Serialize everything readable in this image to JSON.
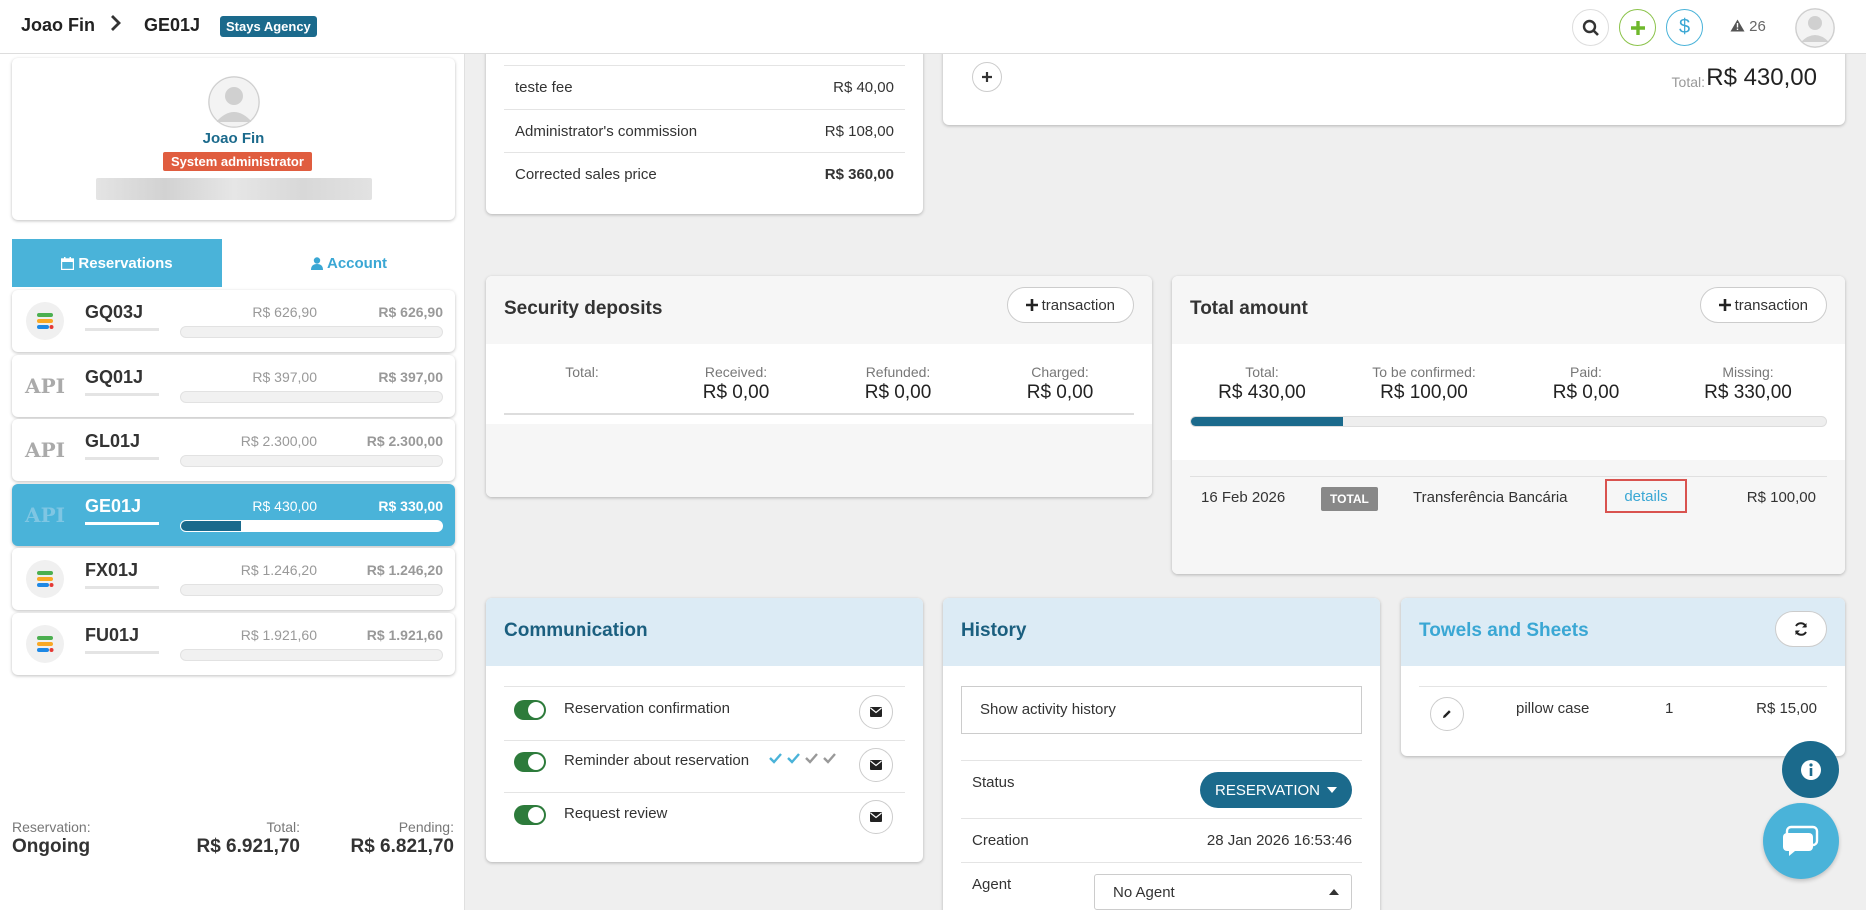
{
  "topbar": {
    "user": "Joao Fin",
    "reservation": "GE01J",
    "agency": "Stays Agency",
    "alert_count": "26"
  },
  "sidebar": {
    "profile": {
      "name": "Joao Fin",
      "role": "System administrator"
    },
    "tabs": {
      "reservations": "Reservations",
      "account": "Account"
    },
    "reservations": [
      {
        "code": "GQ03J",
        "icon": "stack-icon",
        "total": "R$ 626,90",
        "pending": "R$ 626,90",
        "paid_fraction": 0,
        "active": false
      },
      {
        "code": "GQ01J",
        "icon": "api-icon",
        "total": "R$ 397,00",
        "pending": "R$ 397,00",
        "paid_fraction": 0,
        "active": false
      },
      {
        "code": "GL01J",
        "icon": "api-icon",
        "total": "R$ 2.300,00",
        "pending": "R$ 2.300,00",
        "paid_fraction": 0,
        "active": false
      },
      {
        "code": "GE01J",
        "icon": "api-icon",
        "total": "R$ 430,00",
        "pending": "R$ 330,00",
        "paid_fraction": 0.23,
        "active": true
      },
      {
        "code": "FX01J",
        "icon": "stack-icon",
        "total": "R$ 1.246,20",
        "pending": "R$ 1.246,20",
        "paid_fraction": 0,
        "active": false
      },
      {
        "code": "FU01J",
        "icon": "stack-icon",
        "total": "R$ 1.921,60",
        "pending": "R$ 1.921,60",
        "paid_fraction": 0,
        "active": false
      }
    ],
    "footer": {
      "reservation_label": "Reservation:",
      "reservation_value": "Ongoing",
      "total_label": "Total:",
      "total_value": "R$ 6.921,70",
      "pending_label": "Pending:",
      "pending_value": "R$ 6.821,70"
    }
  },
  "price_panel": {
    "rows": [
      {
        "label": "teste fee",
        "value": "R$ 40,00"
      },
      {
        "label": "Administrator's commission",
        "value": "R$ 108,00"
      },
      {
        "label": "Corrected sales price",
        "value": "R$ 360,00"
      }
    ]
  },
  "fees_panel": {
    "total_label": "Total:",
    "total_value": "R$ 430,00"
  },
  "security_deposits": {
    "title": "Security deposits",
    "button": "transaction",
    "total_label": "Total:",
    "received_label": "Received:",
    "received": "R$ 0,00",
    "refunded_label": "Refunded:",
    "refunded": "R$ 0,00",
    "charged_label": "Charged:",
    "charged": "R$ 0,00"
  },
  "total_amount": {
    "title": "Total amount",
    "button": "transaction",
    "total_label": "Total:",
    "total": "R$ 430,00",
    "tbc_label": "To be confirmed:",
    "tbc": "R$ 100,00",
    "paid_label": "Paid:",
    "paid": "R$ 0,00",
    "missing_label": "Missing:",
    "missing": "R$ 330,00",
    "progress_fraction": 0.24,
    "transaction": {
      "date": "16 Feb 2026",
      "badge": "TOTAL",
      "method": "Transferência Bancária",
      "link": "details",
      "amount": "R$ 100,00"
    }
  },
  "communication": {
    "title": "Communication",
    "items": [
      {
        "label": "Reservation confirmation"
      },
      {
        "label": "Reminder about reservation"
      },
      {
        "label": "Request review"
      }
    ]
  },
  "history": {
    "title": "History",
    "show_activity": "Show activity history",
    "status_label": "Status",
    "status_value": "RESERVATION",
    "creation_label": "Creation",
    "creation_value": "28 Jan 2026 16:53:46",
    "agent_label": "Agent",
    "agent_value": "No Agent"
  },
  "towels": {
    "title": "Towels and Sheets",
    "item": {
      "name": "pillow case",
      "qty": "1",
      "price": "R$ 15,00"
    }
  },
  "colors": {
    "primary": "#1b6a8c",
    "accent": "#4ab3d9",
    "danger": "#e05d3f",
    "success": "#2d7b3b"
  }
}
